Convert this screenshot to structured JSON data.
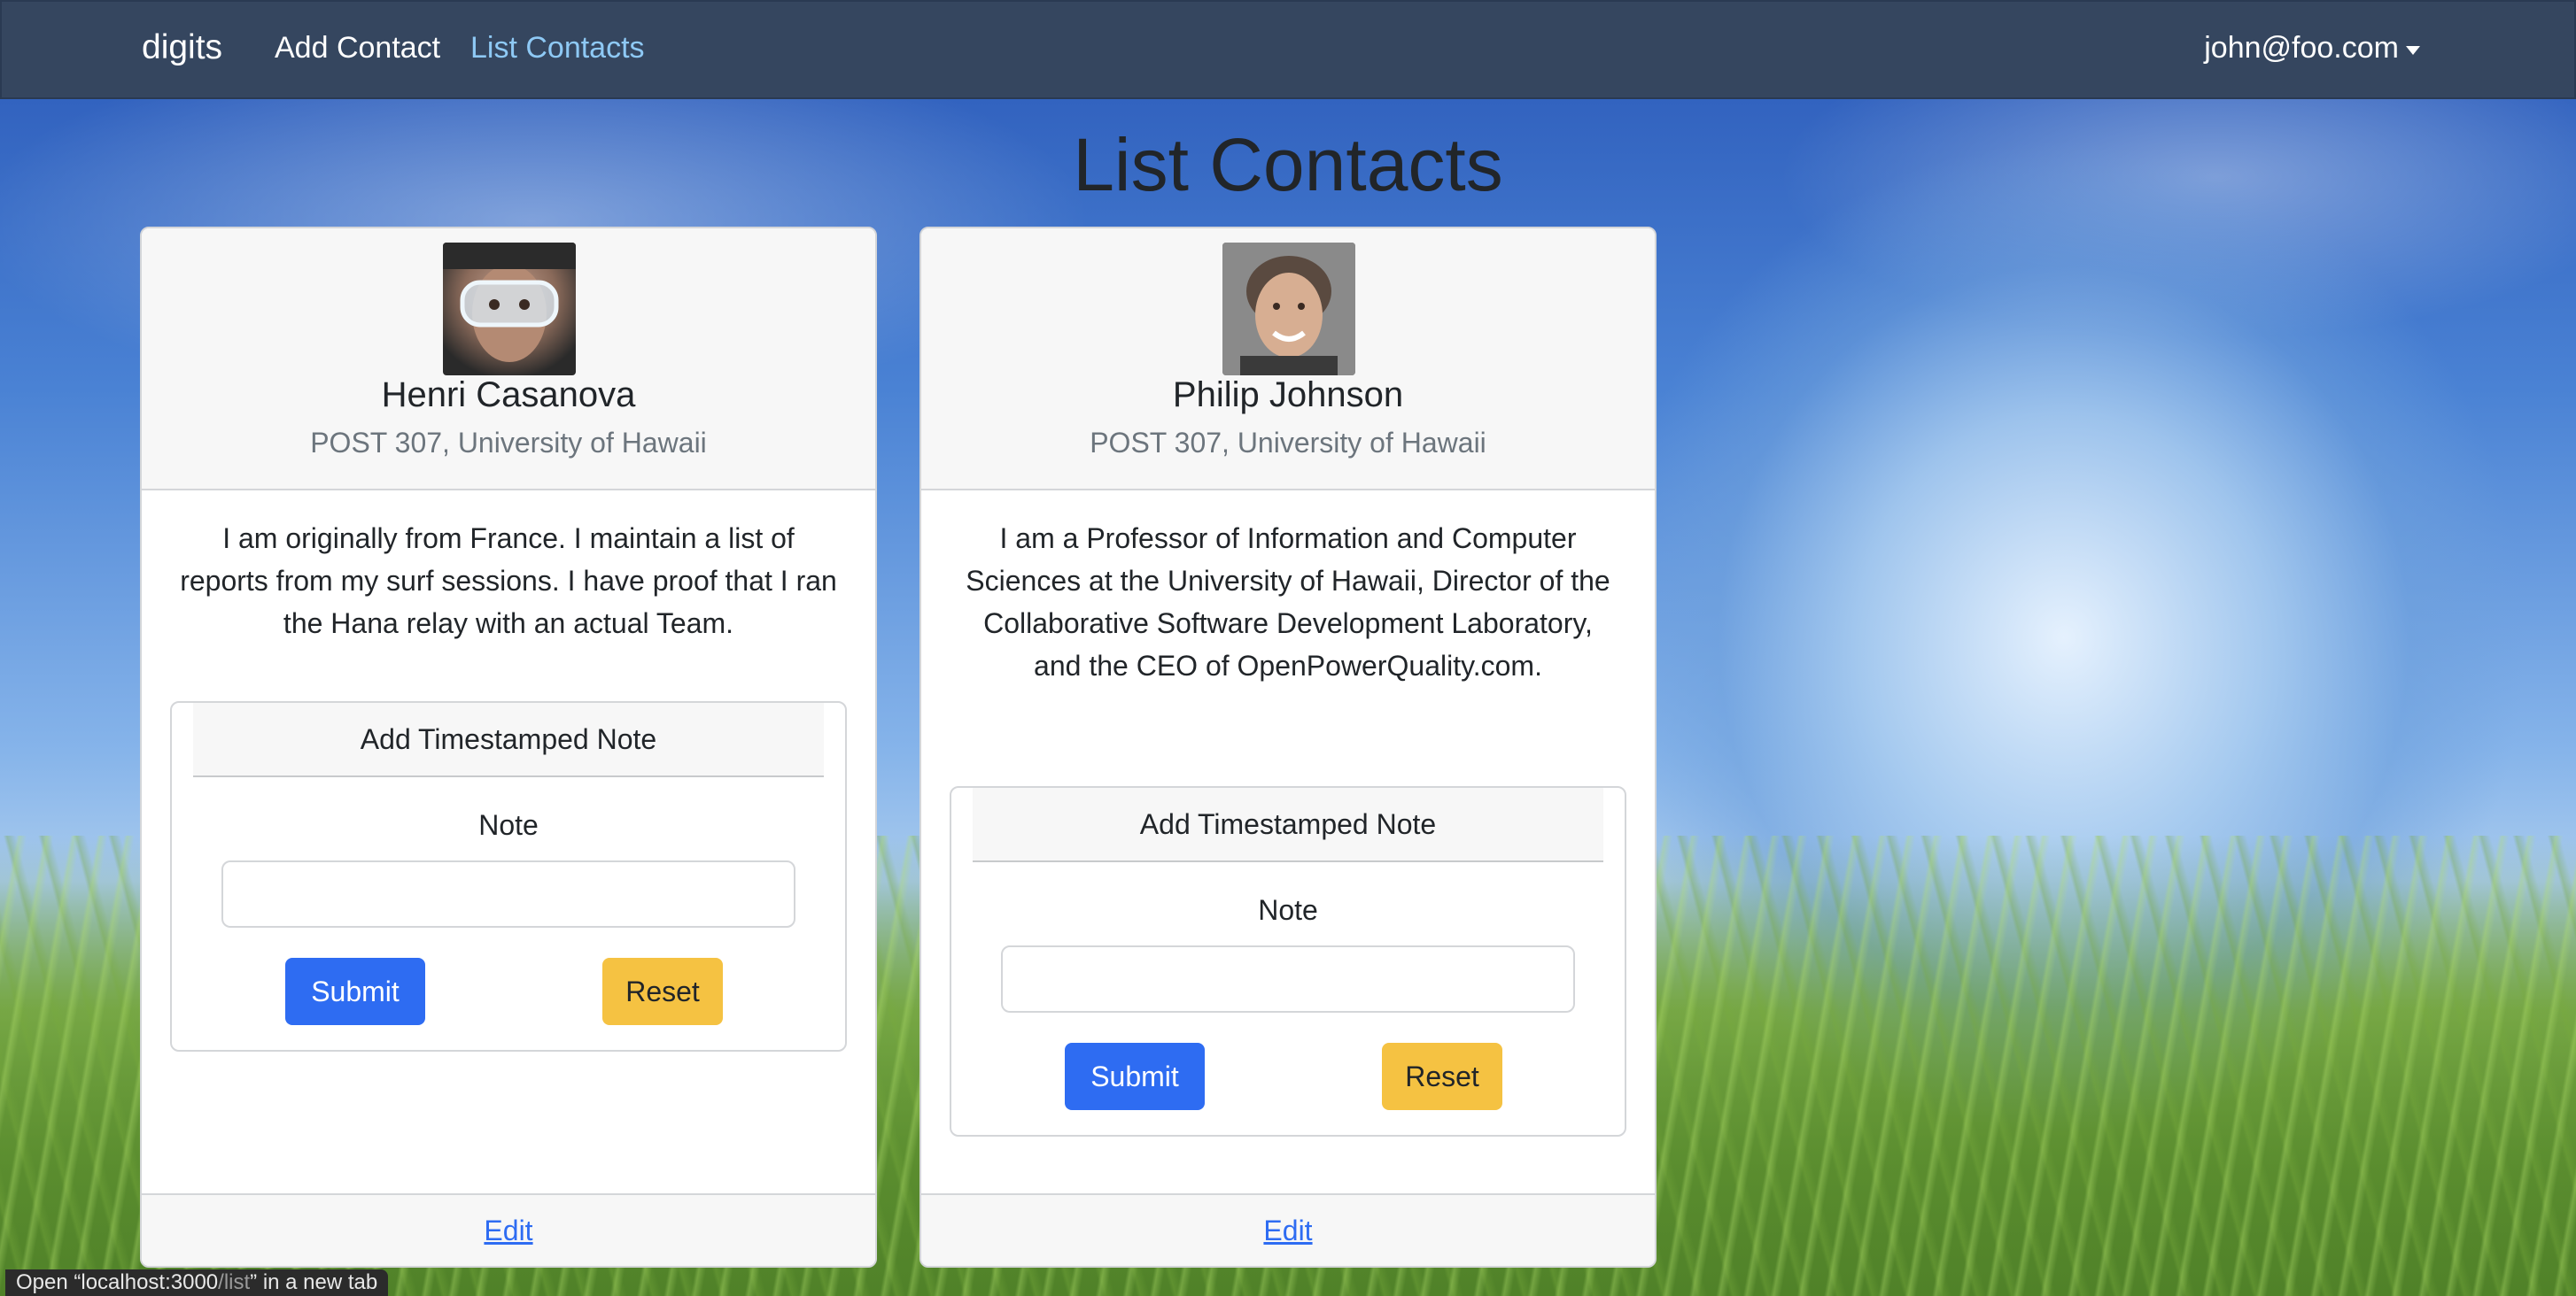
{
  "navbar": {
    "brand": "digits",
    "links": [
      {
        "label": "Add Contact"
      },
      {
        "label": "List Contacts"
      }
    ],
    "user": "john@foo.com"
  },
  "page": {
    "title": "List Contacts"
  },
  "contacts": [
    {
      "name": "Henri Casanova",
      "address": "POST 307, University of Hawaii",
      "description": "I am originally from France. I maintain a list of reports from my surf sessions. I have proof that I ran the Hana relay with an actual Team.",
      "note_title": "Add Timestamped Note",
      "note_label": "Note",
      "note_value": "",
      "submit_label": "Submit",
      "reset_label": "Reset",
      "edit_label": "Edit"
    },
    {
      "name": "Philip Johnson",
      "address": "POST 307, University of Hawaii",
      "description": "I am a Professor of Information and Computer Sciences at the University of Hawaii, Director of the Collaborative Software Development Laboratory, and the CEO of OpenPowerQuality.com.",
      "note_title": "Add Timestamped Note",
      "note_label": "Note",
      "note_value": "",
      "submit_label": "Submit",
      "reset_label": "Reset",
      "edit_label": "Edit"
    }
  ],
  "status_bar": {
    "prefix": "Open “localhost:3000",
    "path": "/list",
    "suffix": "” in a new tab"
  },
  "colors": {
    "navbar": "#35465f",
    "active_link": "#8ec9f5",
    "primary": "#2e6cf2",
    "warning": "#f5c242"
  }
}
